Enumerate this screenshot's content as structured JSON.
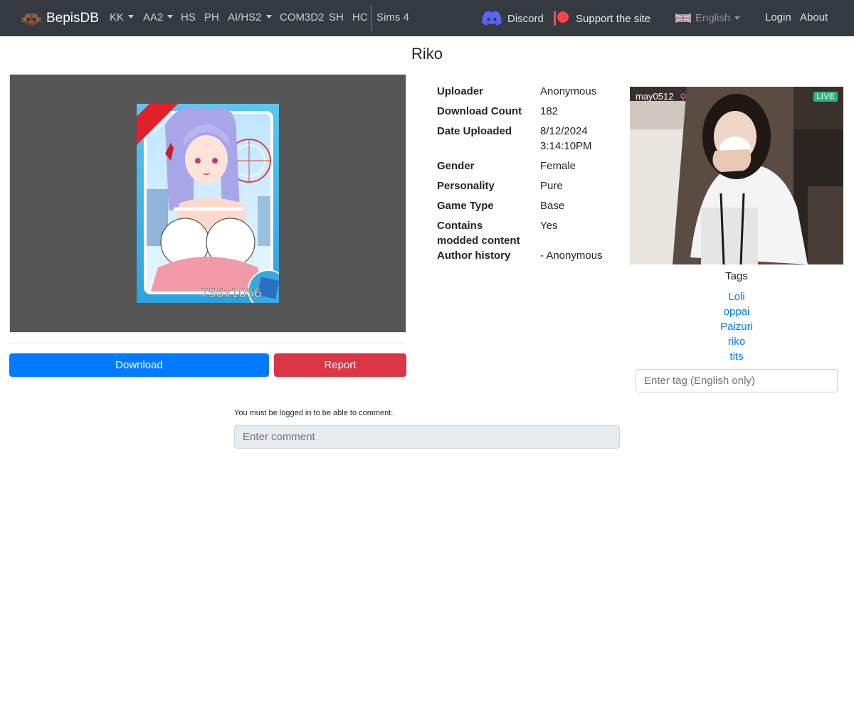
{
  "navbar": {
    "brand": "BepisDB",
    "items": [
      {
        "label": "KK",
        "dropdown": true
      },
      {
        "label": "AA2",
        "dropdown": true
      },
      {
        "label": "HS",
        "dropdown": false
      },
      {
        "label": "PH",
        "dropdown": false
      },
      {
        "label": "AI/HS2",
        "dropdown": true
      },
      {
        "label": "COM3D2",
        "dropdown": false
      },
      {
        "label": "SH",
        "dropdown": false
      },
      {
        "label": "HC",
        "dropdown": false
      },
      {
        "label": "Sims 4",
        "dropdown": false
      }
    ],
    "discord": "Discord",
    "support": "Support the site",
    "language": "English",
    "login": "Login",
    "about": "About"
  },
  "page": {
    "title": "Riko"
  },
  "preview": {
    "card_banner": "CHARA DATA",
    "card_size": "756x1056"
  },
  "actions": {
    "download": "Download",
    "report": "Report"
  },
  "info": [
    {
      "label": "Uploader",
      "value": "Anonymous"
    },
    {
      "label": "Download Count",
      "value": "182"
    },
    {
      "label": "Date Uploaded",
      "value": "8/12/2024\n3:14:10PM"
    },
    {
      "label": "Gender",
      "value": "Female"
    },
    {
      "label": "Personality",
      "value": "Pure"
    },
    {
      "label": "Game Type",
      "value": "Base"
    },
    {
      "label": "Contains\nmodded content",
      "value": "Yes"
    },
    {
      "label": "Author history",
      "value": "- Anonymous"
    }
  ],
  "live_ad": {
    "username": "may0512",
    "badge": "LIVE"
  },
  "tags": {
    "heading": "Tags",
    "items": [
      "Loli",
      "oppai",
      "Paizuri",
      "riko",
      "tits"
    ],
    "input_placeholder": "Enter tag (English only)"
  },
  "comments": {
    "note": "You must be logged in to be able to comment.",
    "input_placeholder": "Enter comment"
  },
  "colors": {
    "navbar_bg": "#343a40",
    "primary": "#007bff",
    "danger": "#dc3545",
    "live_badge": "#2fb380",
    "preview_bg": "#555555"
  }
}
